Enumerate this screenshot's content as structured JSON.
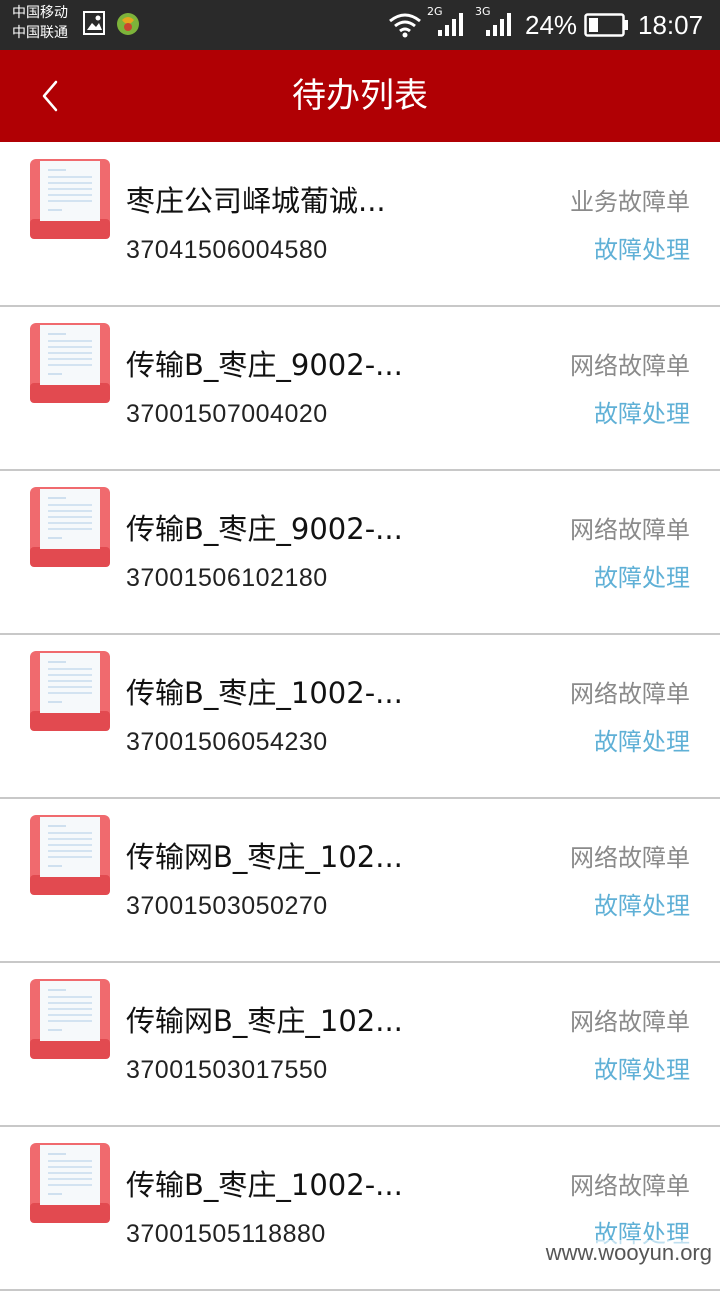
{
  "status_bar": {
    "carrier_1": "中国移动",
    "carrier_2": "中国联通",
    "net_1": "2G",
    "net_2": "3G",
    "battery": "24%",
    "time": "18:07"
  },
  "header": {
    "title": "待办列表",
    "back_icon": "chevron-left-icon"
  },
  "items": [
    {
      "title": "枣庄公司峄城葡诚...",
      "id": "37041506004580",
      "type": "业务故障单",
      "action": "故障处理"
    },
    {
      "title": "传输B_枣庄_9002-...",
      "id": "37001507004020",
      "type": "网络故障单",
      "action": "故障处理"
    },
    {
      "title": "传输B_枣庄_9002-...",
      "id": "37001506102180",
      "type": "网络故障单",
      "action": "故障处理"
    },
    {
      "title": "传输B_枣庄_1002-...",
      "id": "37001506054230",
      "type": "网络故障单",
      "action": "故障处理"
    },
    {
      "title": "传输网B_枣庄_102...",
      "id": "37001503050270",
      "type": "网络故障单",
      "action": "故障处理"
    },
    {
      "title": "传输网B_枣庄_102...",
      "id": "37001503017550",
      "type": "网络故障单",
      "action": "故障处理"
    },
    {
      "title": "传输B_枣庄_1002-...",
      "id": "37001505118880",
      "type": "网络故障单",
      "action": "故障处理"
    }
  ],
  "watermark": "www.wooyun.org",
  "colors": {
    "header_bg": "#b00004",
    "status_bg": "#2a2a2a",
    "action": "#5fb0d6",
    "icon_red": "#f06a6e"
  }
}
